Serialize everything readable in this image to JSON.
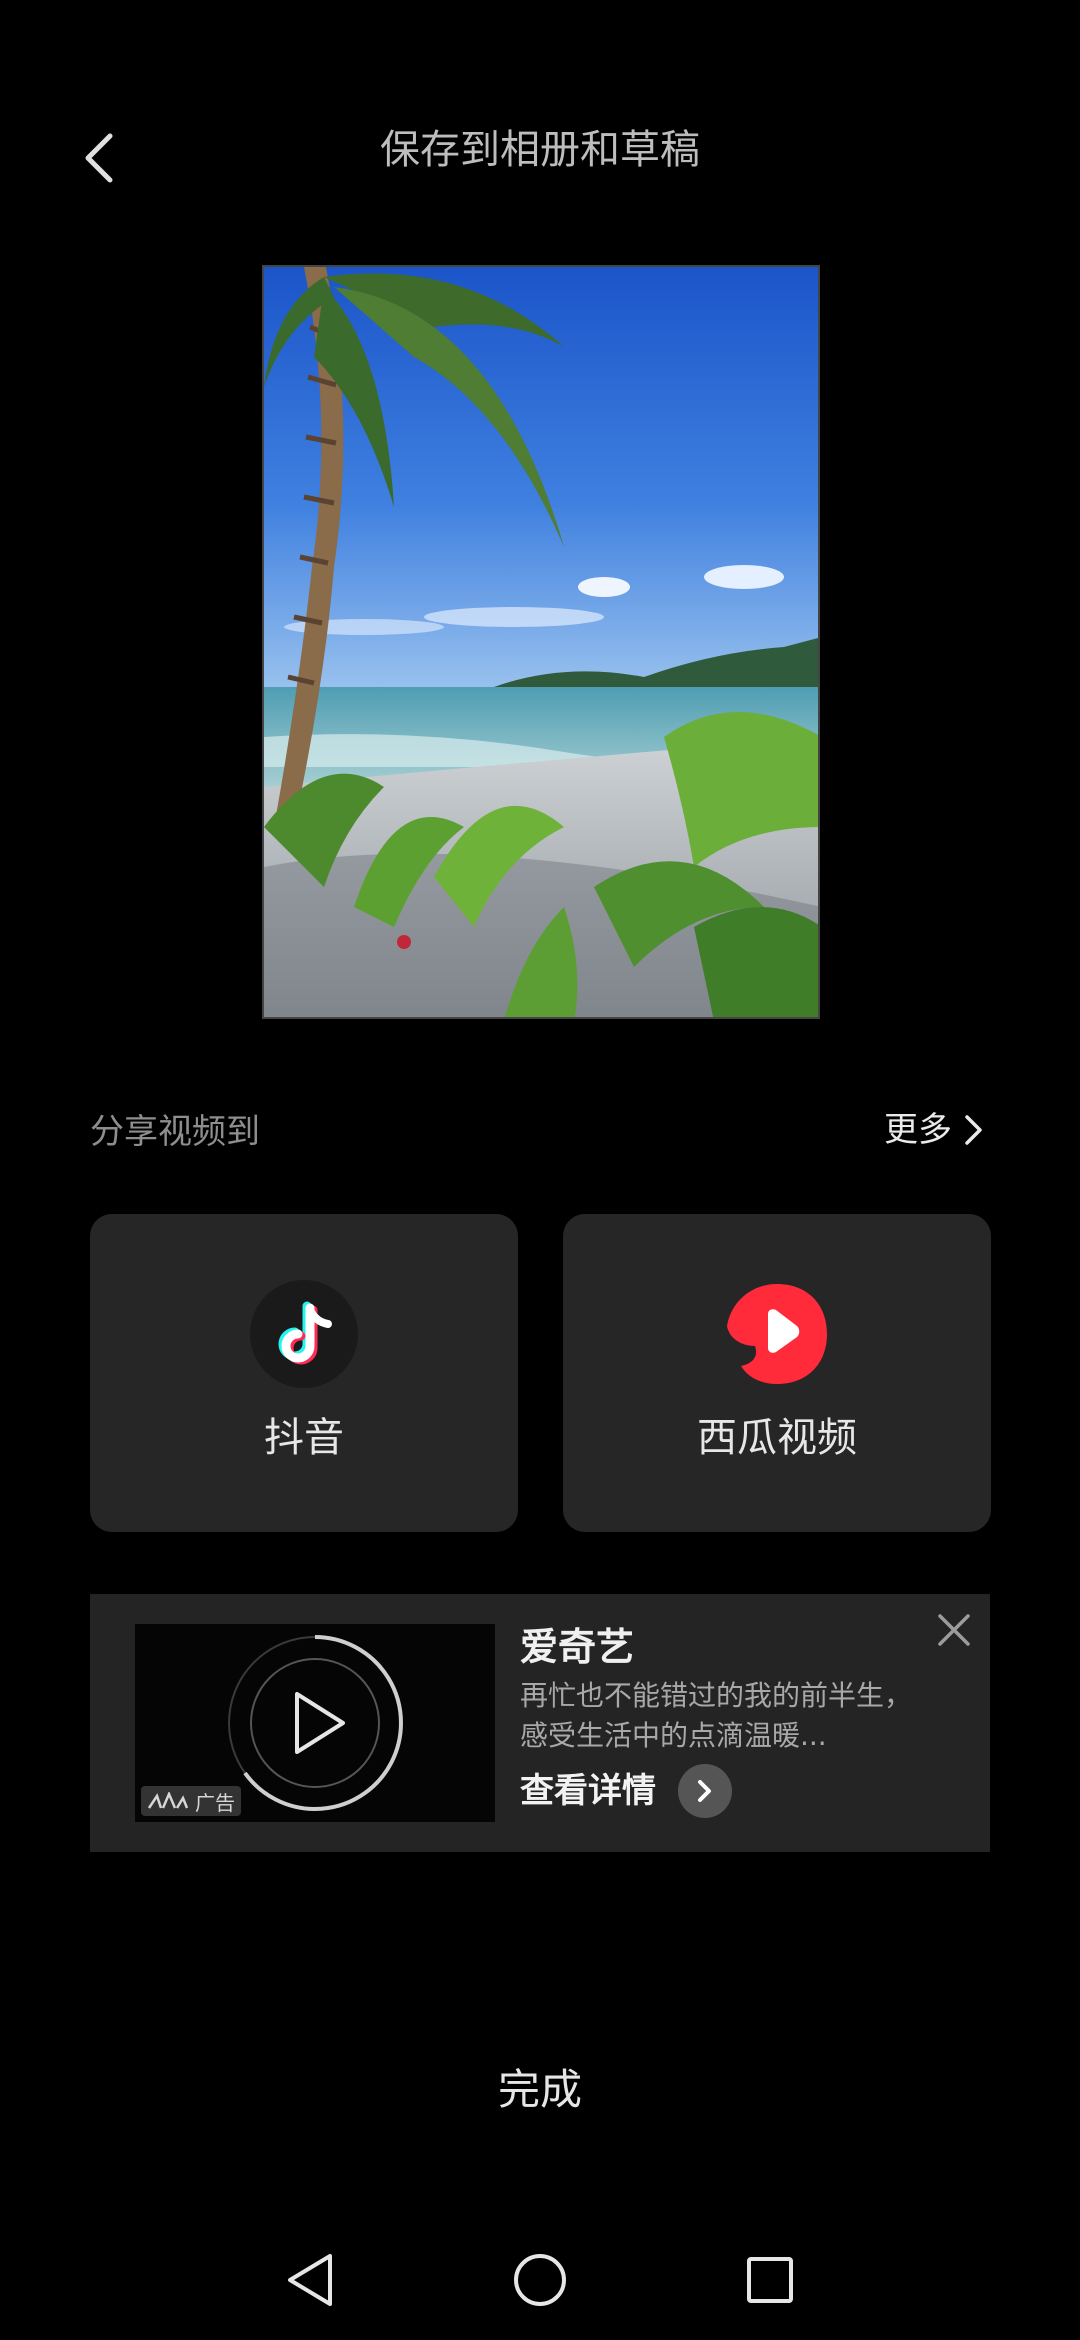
{
  "header": {
    "title": "保存到相册和草稿",
    "back_icon": "chevron-left-icon"
  },
  "share": {
    "label": "分享视频到",
    "more_label": "更多",
    "targets": [
      {
        "name": "抖音",
        "icon": "douyin-icon",
        "color": "#1a1a1a"
      },
      {
        "name": "西瓜视频",
        "icon": "xigua-icon",
        "color": "#ff2b3b"
      }
    ]
  },
  "ad": {
    "title": "爱奇艺",
    "description": "再忙也不能错过的我的前半生，感受生活中的点滴温暖...",
    "cta_label": "查看详情",
    "tag": "广告"
  },
  "done_label": "完成",
  "nav": {
    "back": "nav-back-icon",
    "home": "nav-home-icon",
    "recent": "nav-recent-icon"
  }
}
